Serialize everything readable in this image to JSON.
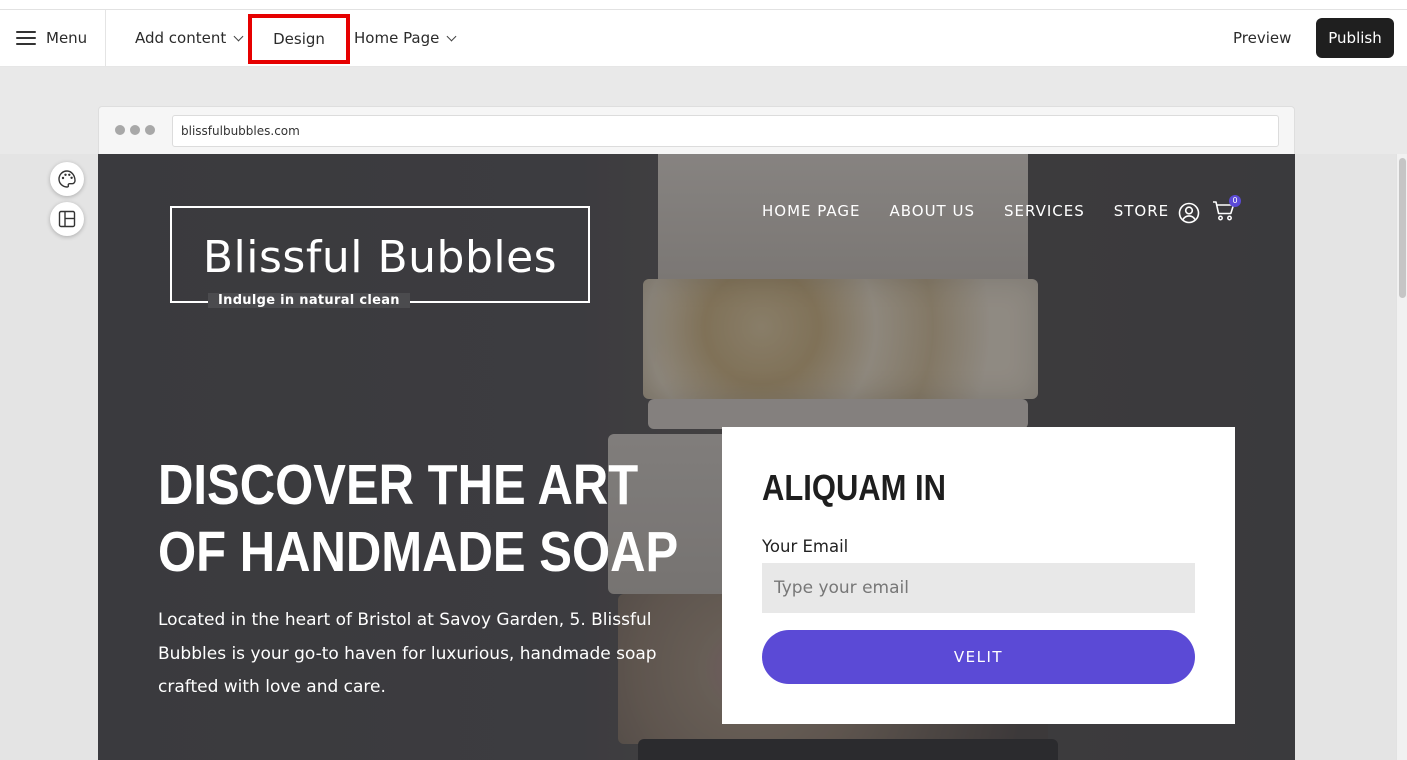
{
  "toolbar": {
    "menu_label": "Menu",
    "add_content_label": "Add content",
    "design_label": "Design",
    "page_selector_label": "Home Page",
    "preview_label": "Preview",
    "publish_label": "Publish"
  },
  "browser": {
    "url": "blissfulbubbles.com"
  },
  "site": {
    "logo_title": "Blissful Bubbles",
    "logo_tagline": "Indulge in natural clean",
    "nav": [
      "HOME PAGE",
      "ABOUT US",
      "SERVICES",
      "STORE"
    ],
    "cart_count": "0",
    "hero": {
      "headline_line1": "DISCOVER THE ART",
      "headline_line2": "OF HANDMADE SOAP",
      "subcopy": "Located in the heart of Bristol at Savoy Garden, 5. Blissful Bubbles is your go-to haven for luxurious, handmade soap crafted with love and care."
    },
    "form": {
      "title": "ALIQUAM IN",
      "email_label": "Your Email",
      "email_placeholder": "Type your email",
      "button_label": "VELIT"
    }
  },
  "colors": {
    "highlight_border": "#e60000",
    "publish_bg": "#1f1f1f",
    "accent": "#5b4ad6"
  },
  "icons": [
    "hamburger-icon",
    "chevron-down-icon",
    "palette-icon",
    "layout-icon",
    "user-icon",
    "cart-icon"
  ]
}
